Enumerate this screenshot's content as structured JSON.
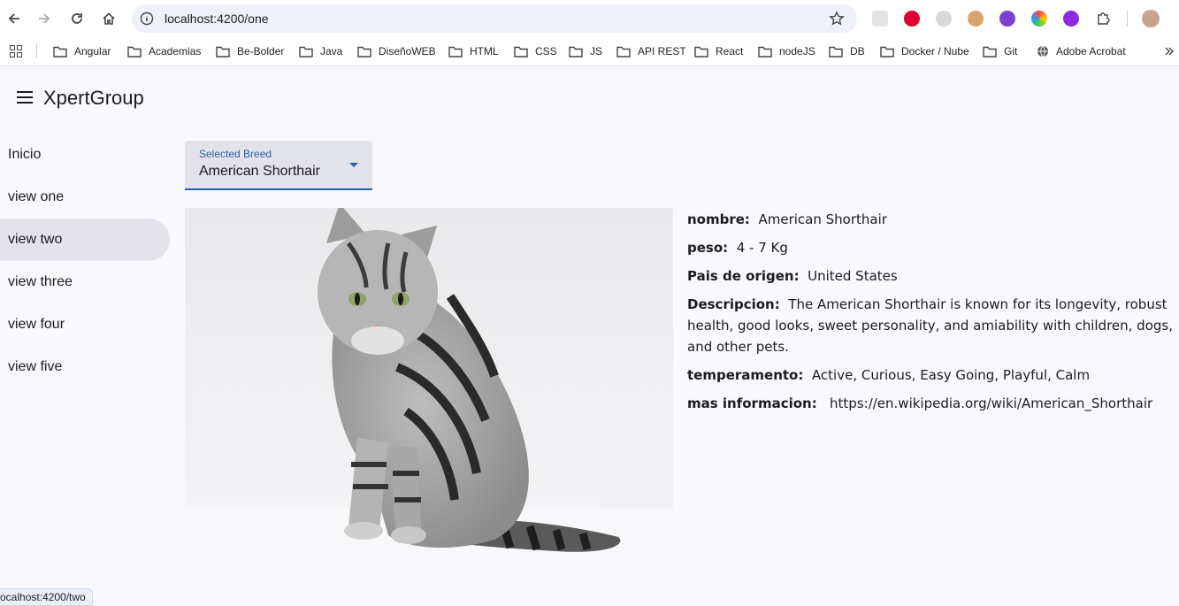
{
  "browser": {
    "url": "localhost:4200/one",
    "bookmarks": [
      "Angular",
      "Academias",
      "Be-Bolder",
      "Java",
      "DiseñoWEB",
      "HTML",
      "CSS",
      "JS",
      "API REST",
      "React",
      "nodeJS",
      "DB",
      "Docker / Nube",
      "Git",
      "Adobe Acrobat"
    ],
    "status_url": "ocalhost:4200/two"
  },
  "app": {
    "title": "XpertGroup",
    "nav": [
      "Inicio",
      "view one",
      "view two",
      "view three",
      "view four",
      "view five"
    ],
    "active_nav": "view two"
  },
  "breed_select": {
    "label": "Selected Breed",
    "value": "American Shorthair"
  },
  "details": {
    "nombre_label": "nombre:",
    "nombre": "American Shorthair",
    "peso_label": "peso:",
    "peso": "4 - 7 Kg",
    "origen_label": "Pais de origen:",
    "origen": "United States",
    "descripcion_label": "Descripcion:",
    "descripcion": "The American Shorthair is known for its longevity, robust health, good looks, sweet personality, and amiability with children, dogs, and other pets.",
    "temperamento_label": "temperamento:",
    "temperamento": "Active, Curious, Easy Going, Playful, Calm",
    "info_label": "mas informacion:",
    "info": "https://en.wikipedia.org/wiki/American_Shorthair"
  },
  "colors": {
    "accent": "#2b5ea7",
    "active_nav_bg": "#e4e2ea",
    "page_bg": "#f9f8fc"
  }
}
